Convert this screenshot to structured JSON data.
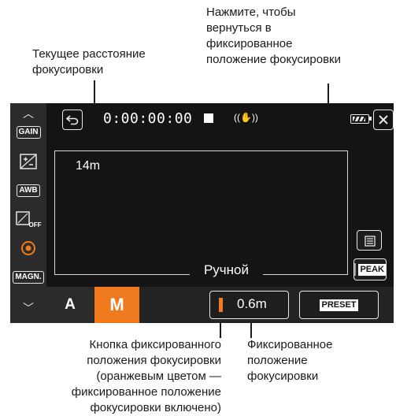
{
  "annotations": {
    "return_to_preset": "Нажмите, чтобы\nвернуться в\nфиксированное\nположение фокусировки",
    "current_distance": "Текущее расстояние\nфокусировки",
    "preset_button": "Кнопка фиксированного\nположения фокусировки\n(оранжевым цветом —\nфиксированное положение\nфокусировки включено)",
    "preset_position": "Фиксированное\nположение\nфокусировки"
  },
  "camera": {
    "timecode": "0:00:00:00",
    "focus_distance": "14m",
    "mode_label": "Ручной",
    "preset_distance": "0.6m",
    "preset_button_label": "PRESET",
    "peak_button_label": "PEAK",
    "auto_button_label": "A",
    "manual_button_label": "M",
    "menu_items": [
      "GAIN",
      "AWB",
      "OFF",
      "MAGN."
    ],
    "accent_color": "#f07b1e"
  }
}
